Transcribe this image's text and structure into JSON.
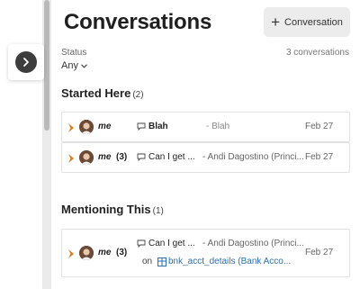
{
  "header": {
    "title": "Conversations",
    "new_button_label": "Conversation"
  },
  "filter": {
    "status_label": "Status",
    "status_value": "Any",
    "count_text": "3 conversations"
  },
  "started": {
    "title": "Started Here",
    "count": "(2)",
    "rows": [
      {
        "who": "me",
        "count": "",
        "topic": "Blah",
        "snippet": "- Blah",
        "date": "Feb 27"
      },
      {
        "who": "me",
        "count": "(3)",
        "topic": "Can I get ...",
        "snippet": "- Andi Dagostino (Princi...",
        "date": "Feb 27"
      }
    ]
  },
  "mentioning": {
    "title": "Mentioning This",
    "count": "(1)",
    "rows": [
      {
        "who": "me",
        "count": "(3)",
        "topic": "Can I get ...",
        "snippet": "- Andi Dagostino (Princi...",
        "date": "Feb 27",
        "on_label": "on",
        "link_text": "bnk_acct_details (Bank Acco..."
      }
    ]
  },
  "colors": {
    "flag": "#e07a18",
    "link": "#2a6fb0",
    "button_bg": "#ececec"
  },
  "icons": {
    "expand": "chevron-right-icon",
    "add": "plus-icon",
    "comment": "speech-bubble-icon",
    "table": "table-icon",
    "dropdown": "chevron-down-icon"
  }
}
